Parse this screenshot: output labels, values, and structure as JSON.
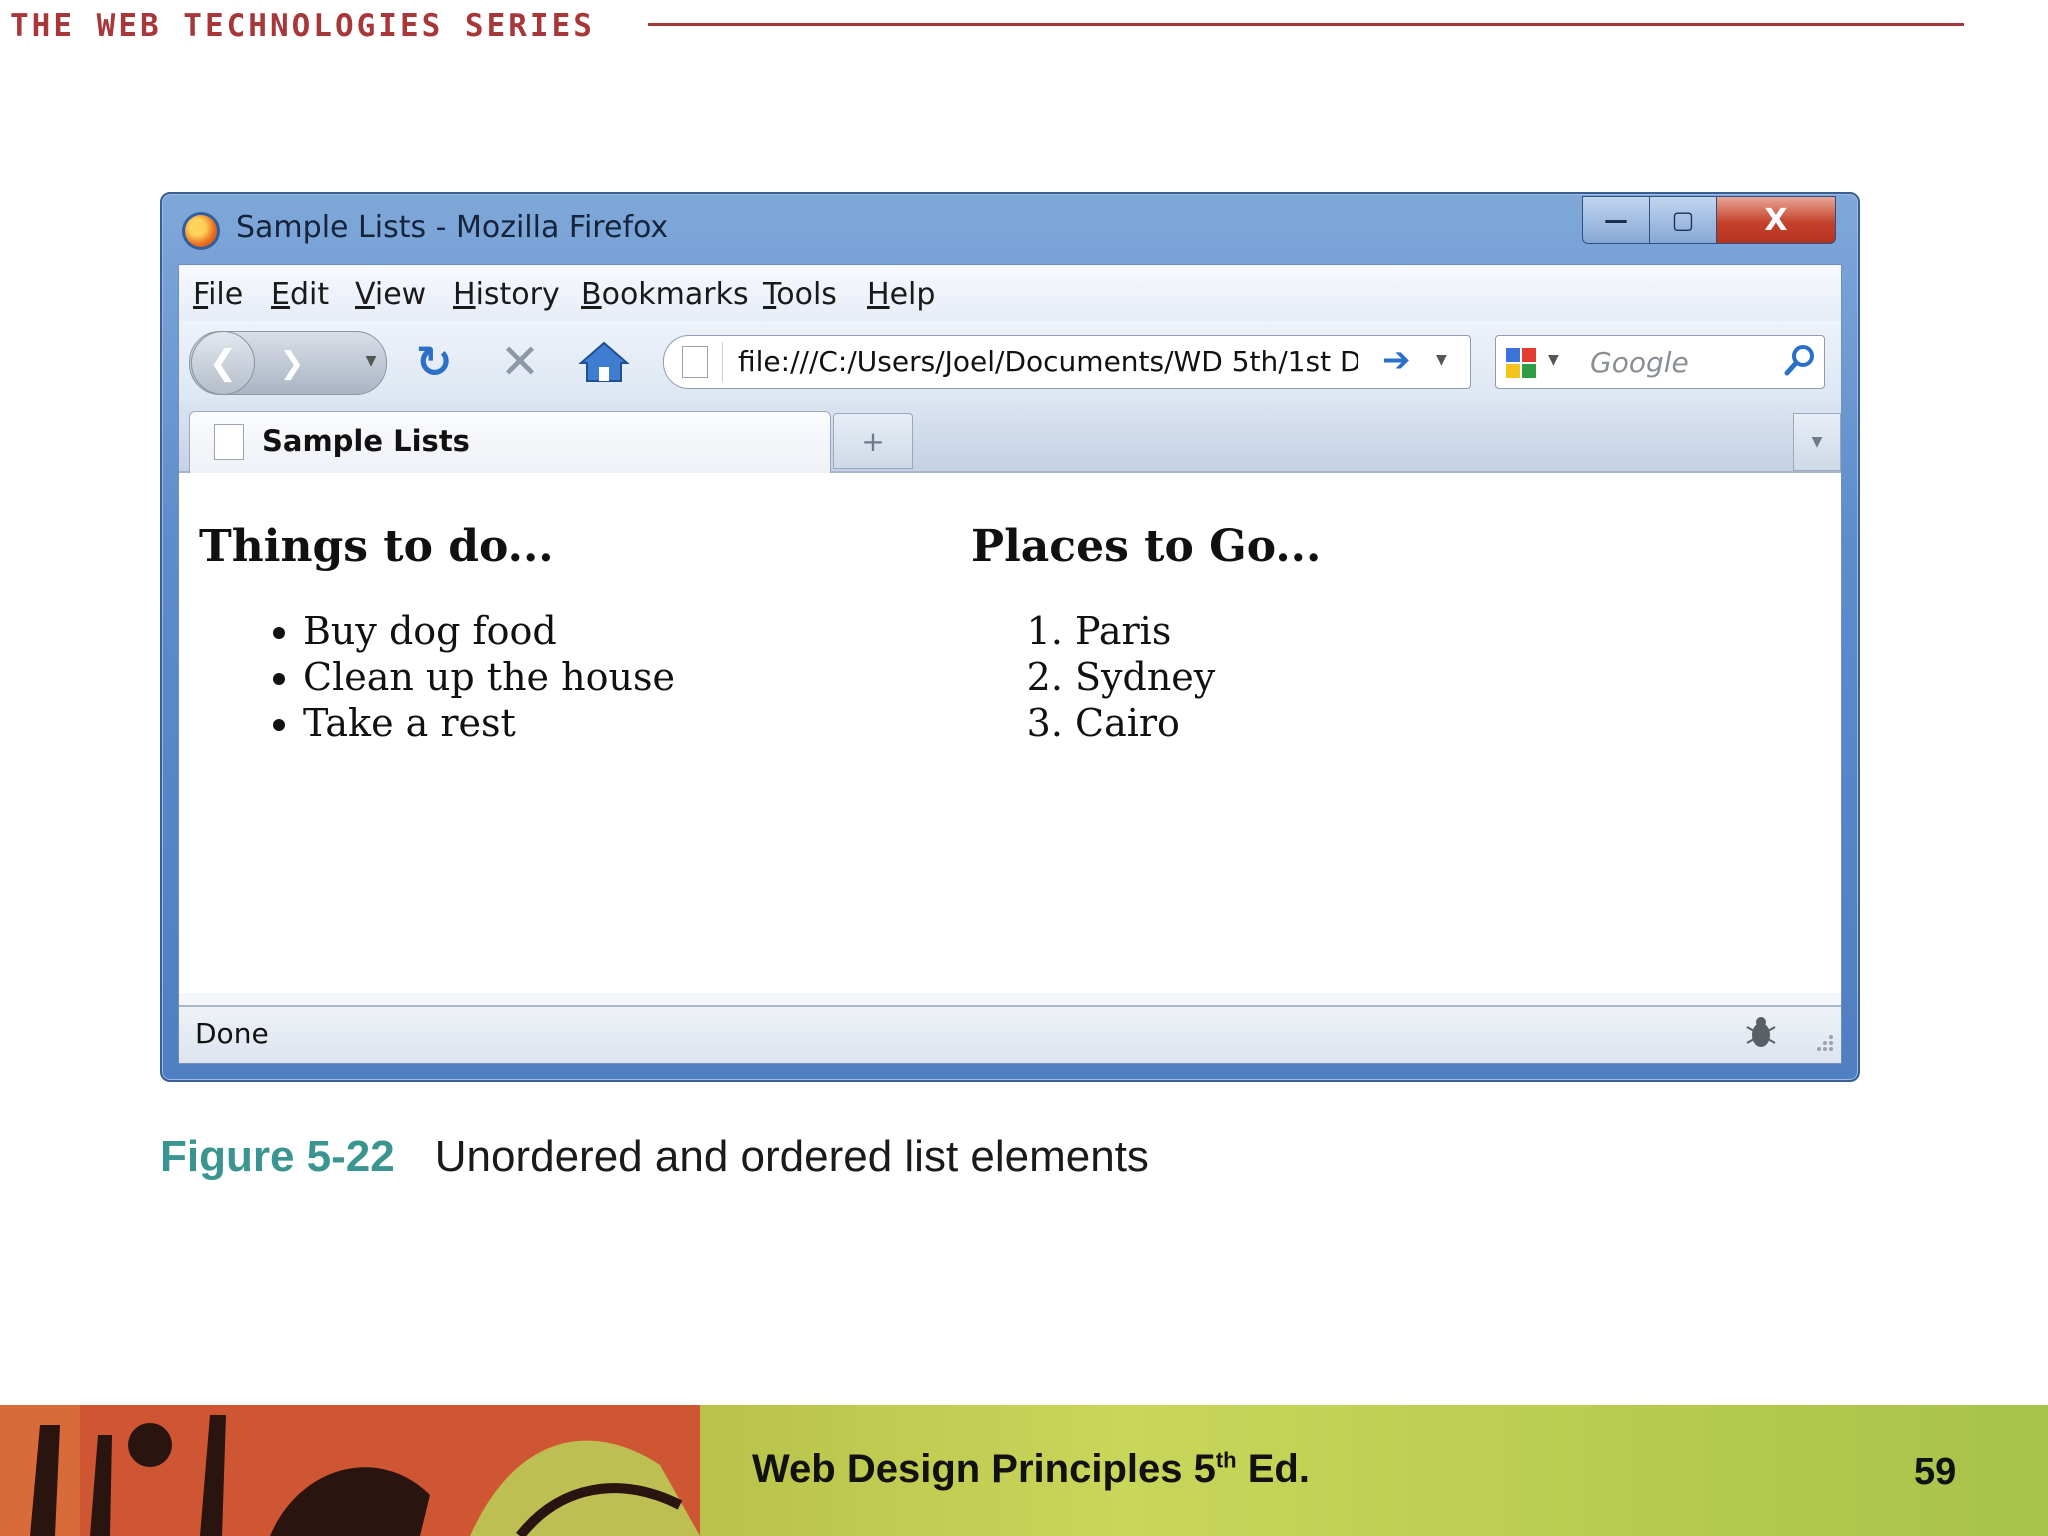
{
  "slide": {
    "series_title": "THE WEB TECHNOLOGIES SERIES",
    "caption_number": "Figure 5-22",
    "caption_text": "Unordered and ordered list elements",
    "footer_title_prefix": "Web Design Principles 5",
    "footer_title_sup": "th",
    "footer_title_suffix": " Ed.",
    "page_number": "59"
  },
  "window": {
    "title": "Sample Lists - Mozilla Firefox",
    "controls": {
      "minimize": "—",
      "maximize": "▢",
      "close": "X"
    }
  },
  "menu": [
    "File",
    "Edit",
    "View",
    "History",
    "Bookmarks",
    "Tools",
    "Help"
  ],
  "navbar": {
    "url": "file:///C:/Users/Joel/Documents/WD 5th/1st D",
    "search_placeholder": "Google"
  },
  "tabs": [
    {
      "label": "Sample Lists"
    }
  ],
  "page": {
    "left_heading": "Things to do...",
    "unordered_items": [
      "Buy dog food",
      "Clean up the house",
      "Take a rest"
    ],
    "right_heading": "Places to Go...",
    "ordered_items": [
      "Paris",
      "Sydney",
      "Cairo"
    ]
  },
  "statusbar": {
    "text": "Done"
  },
  "colors": {
    "accent_red": "#a8373a",
    "caption_teal": "#3a9590",
    "window_blue": "#5d8ccb"
  }
}
